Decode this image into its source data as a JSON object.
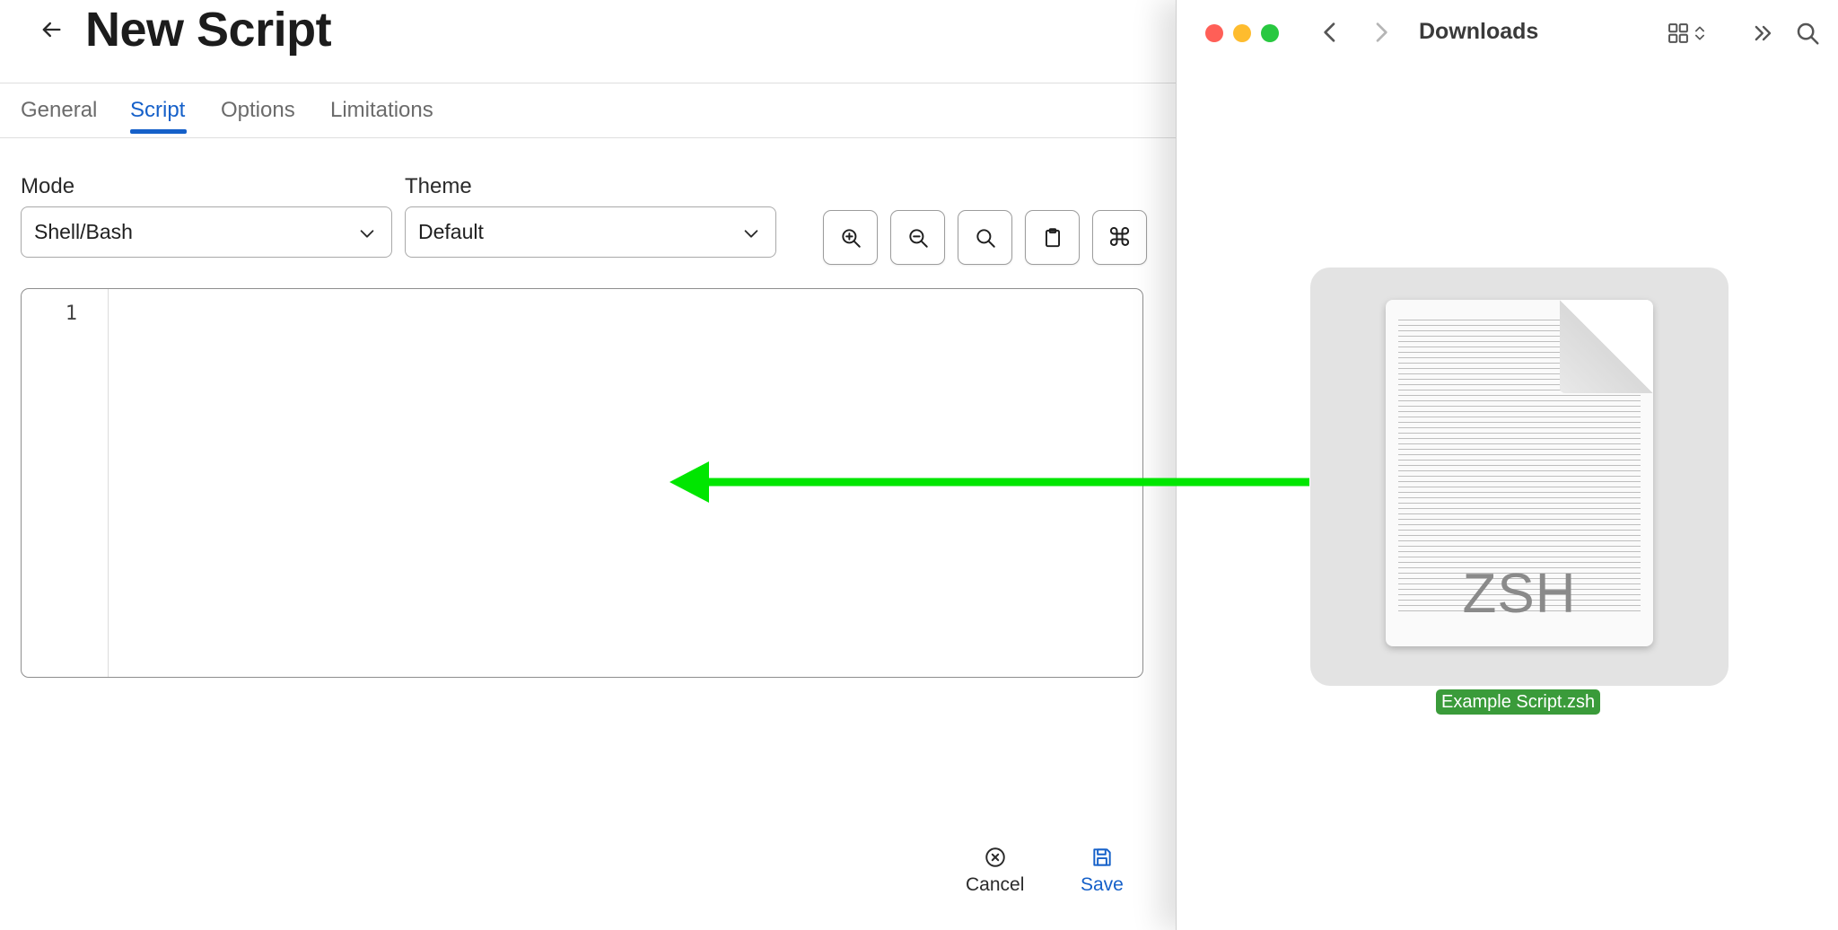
{
  "editor": {
    "title": "New Script",
    "tabs": [
      {
        "label": "General",
        "active": false
      },
      {
        "label": "Script",
        "active": true
      },
      {
        "label": "Options",
        "active": false
      },
      {
        "label": "Limitations",
        "active": false
      }
    ],
    "mode": {
      "label": "Mode",
      "value": "Shell/Bash"
    },
    "theme": {
      "label": "Theme",
      "value": "Default"
    },
    "toolbar_icons": [
      "zoom-in-icon",
      "zoom-out-icon",
      "search-icon",
      "clipboard-icon",
      "command-icon"
    ],
    "command_glyph": "⌘",
    "code": {
      "line_numbers": [
        "1"
      ],
      "content": ""
    },
    "footer": {
      "cancel_label": "Cancel",
      "save_label": "Save"
    },
    "accent_color": "#1560c9"
  },
  "finder": {
    "title": "Downloads",
    "traffic_lights": [
      "#ff5f57",
      "#febc2e",
      "#28c840"
    ],
    "file": {
      "name": "Example Script.zsh",
      "type_label": "ZSH",
      "selection_color": "#3a9b3a"
    }
  },
  "annotation": {
    "arrow_color": "#00e600"
  }
}
